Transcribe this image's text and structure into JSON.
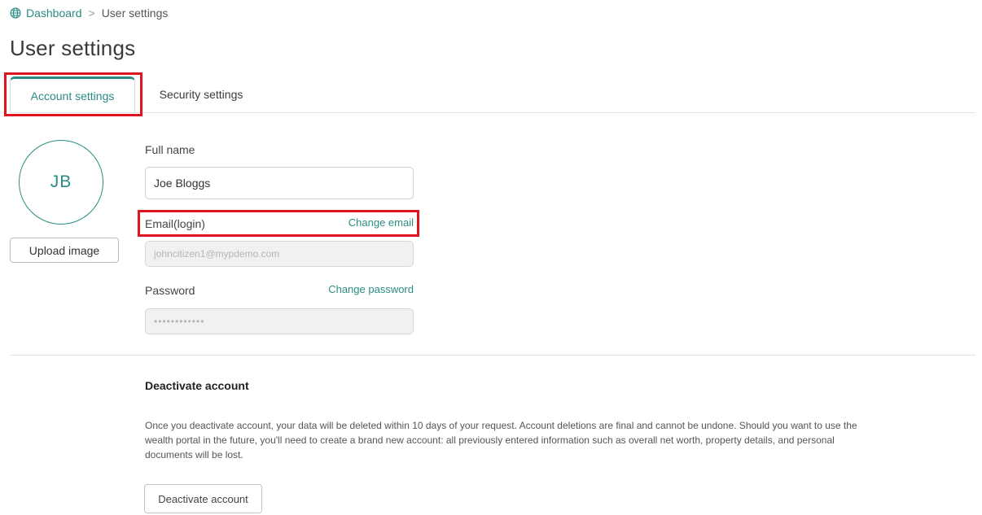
{
  "breadcrumb": {
    "home": "Dashboard",
    "separator": ">",
    "current": "User settings"
  },
  "page": {
    "title": "User settings"
  },
  "tabs": [
    {
      "label": "Account settings",
      "active": true
    },
    {
      "label": "Security settings",
      "active": false
    }
  ],
  "avatar": {
    "initials": "JB",
    "upload_label": "Upload image"
  },
  "form": {
    "full_name_label": "Full name",
    "full_name_value": "Joe Bloggs",
    "email_label": "Email(login)",
    "change_email_label": "Change email",
    "email_value": "johncitizen1@mypdemo.com",
    "password_label": "Password",
    "change_password_label": "Change password",
    "password_value": "••••••••••••"
  },
  "deactivate": {
    "title": "Deactivate account",
    "description": "Once you deactivate account, your data will be deleted within 10 days of your request. Account deletions are final and cannot be undone. Should you want to use the wealth portal in the future, you'll need to create a brand new account: all previously entered information such as overall net worth, property details, and personal documents will be lost.",
    "button_label": "Deactivate account"
  },
  "colors": {
    "accent": "#2a8c84",
    "highlight": "#e0141e"
  },
  "icons": {
    "breadcrumb_home": "globe-icon"
  }
}
